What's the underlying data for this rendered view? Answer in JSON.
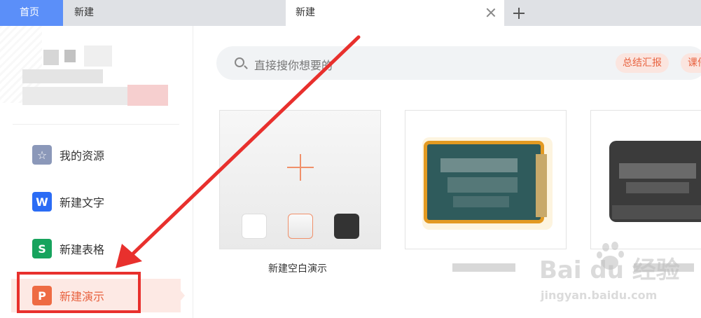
{
  "tabs": [
    {
      "label": "首页"
    },
    {
      "label": "新建"
    },
    {
      "label": "新建"
    }
  ],
  "sidebar": {
    "items": [
      {
        "label": "我的资源",
        "icon": "star-icon",
        "color": "#8b98b9",
        "glyph": "☆"
      },
      {
        "label": "新建文字",
        "icon": "writer-icon",
        "color": "#2b6cf5",
        "glyph": "W"
      },
      {
        "label": "新建表格",
        "icon": "sheet-icon",
        "color": "#17a35d",
        "glyph": "S"
      },
      {
        "label": "新建演示",
        "icon": "presentation-icon",
        "color": "#ee6b43",
        "glyph": "P"
      }
    ]
  },
  "search": {
    "placeholder": "直接搜你想要的",
    "chips": [
      "总结汇报",
      "课件"
    ]
  },
  "cards": [
    {
      "label": "新建空白演示"
    }
  ],
  "watermark": {
    "brand": "Bai du 经验",
    "url": "jingyan.baidu.com"
  },
  "colors": {
    "accent": "#e8623f",
    "home_tab": "#5b8ff9",
    "annotation": "#e8302d"
  }
}
